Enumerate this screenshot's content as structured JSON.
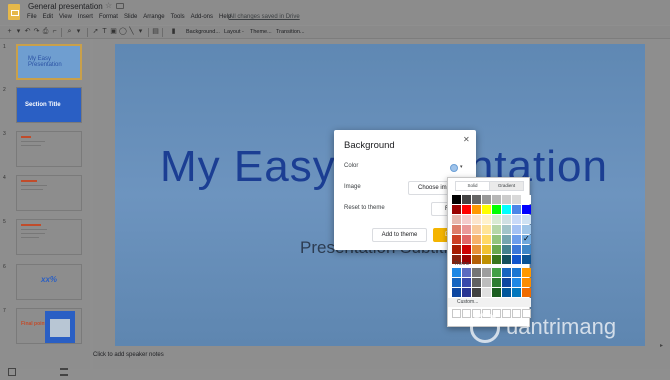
{
  "app": {
    "doc_title": "General presentation",
    "save_status": "All changes saved in Drive",
    "menu": [
      "File",
      "Edit",
      "View",
      "Insert",
      "Format",
      "Slide",
      "Arrange",
      "Tools",
      "Add-ons",
      "Help"
    ]
  },
  "toolbar": {
    "background_label": "Background...",
    "layout_label": "Layout -",
    "theme_label": "Theme...",
    "transition_label": "Transition..."
  },
  "filmstrip": {
    "slides": [
      {
        "num": "1",
        "text": "My Easy Presentation"
      },
      {
        "num": "2",
        "text": "Section Title"
      },
      {
        "num": "3",
        "text": ""
      },
      {
        "num": "4",
        "text": ""
      },
      {
        "num": "5",
        "text": ""
      },
      {
        "num": "6",
        "text": "xx%"
      },
      {
        "num": "7",
        "text": "Final point"
      }
    ]
  },
  "slide": {
    "title": "My Easy Presentation",
    "subtitle": "Presentation Subtitle"
  },
  "speaker_notes_placeholder": "Click to add speaker notes",
  "dialog": {
    "title": "Background",
    "color_label": "Color",
    "image_label": "Image",
    "reset_label": "Reset to theme",
    "choose_image_button": "Choose image",
    "reset_button": "Reset",
    "add_to_theme_button": "Add to theme",
    "done_button": "Done"
  },
  "color_picker": {
    "tab_solid": "Solid",
    "tab_gradient": "Gradient",
    "theme_label": "Theme",
    "custom_label": "Custom...",
    "checked_swatch": "#6fa8dc",
    "main_colors": [
      "#000000",
      "#434343",
      "#666666",
      "#999999",
      "#b7b7b7",
      "#cccccc",
      "#d9d9d9",
      "#ffffff",
      "#980000",
      "#ff0000",
      "#ff9900",
      "#ffff00",
      "#00ff00",
      "#00ffff",
      "#4a86e8",
      "#0000ff",
      "#e6b8af",
      "#f4cccc",
      "#fce5cd",
      "#fff2cc",
      "#d9ead3",
      "#d0e0e3",
      "#c9daf8",
      "#cfe2f3",
      "#dd7e6b",
      "#ea9999",
      "#f9cb9c",
      "#ffe599",
      "#b6d7a8",
      "#a2c4c9",
      "#a4c2f4",
      "#9fc5e8",
      "#cc4125",
      "#e06666",
      "#f6b26b",
      "#ffd966",
      "#93c47d",
      "#76a5af",
      "#6d9eeb",
      "#6fa8dc",
      "#a61c00",
      "#cc0000",
      "#e69138",
      "#f1c232",
      "#6aa84f",
      "#45818e",
      "#3c78d8",
      "#3d85c6",
      "#85200c",
      "#990000",
      "#b45f06",
      "#bf9000",
      "#38761d",
      "#134f5c",
      "#1155cc",
      "#0b5394"
    ],
    "theme_colors": [
      "#1e88e5",
      "#5c6bc0",
      "#757575",
      "#9e9e9e",
      "#43a047",
      "#1565c0",
      "#1976d2",
      "#ff9800",
      "#1565c0",
      "#3949ab",
      "#616161",
      "#bdbdbd",
      "#2e7d32",
      "#0d47a1",
      "#1e88e5",
      "#fb8c00",
      "#0d47a1",
      "#283593",
      "#424242",
      "#e0e0e0",
      "#1b5e20",
      "#01579b",
      "#0277bd",
      "#ef6c00"
    ]
  },
  "watermark": {
    "text": "uantrimang"
  }
}
